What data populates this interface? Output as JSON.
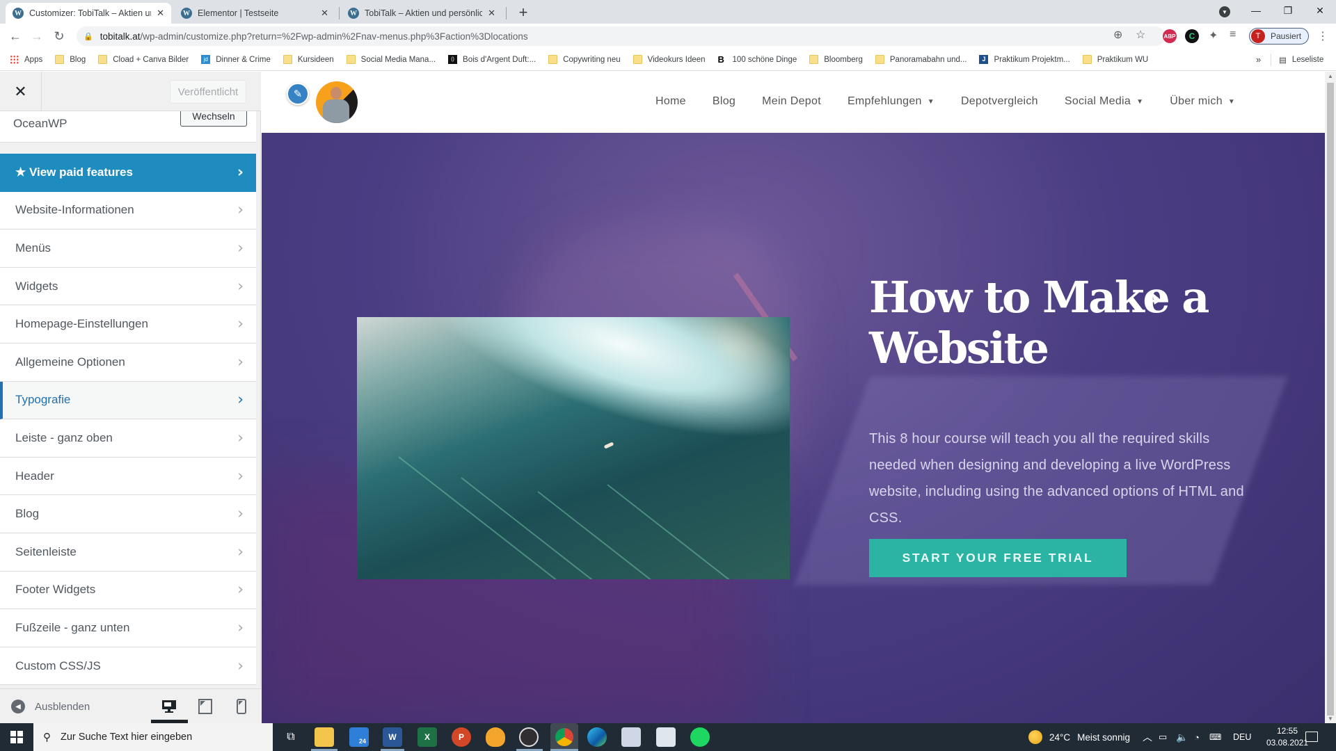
{
  "browser": {
    "tabs": [
      {
        "title": "Customizer: TobiTalk – Aktien und",
        "active": true
      },
      {
        "title": "Elementor | Testseite",
        "active": false
      },
      {
        "title": "TobiTalk – Aktien und persönliche",
        "active": false
      }
    ],
    "new_tab_label": "+",
    "window_controls": {
      "minimize": "—",
      "maximize": "❐",
      "close": "✕"
    },
    "address": {
      "host": "tobitalk.at",
      "path": "/wp-admin/customize.php?return=%2Fwp-admin%2Fnav-menus.php%3Faction%3Dlocations"
    },
    "profile": {
      "initial": "T",
      "status": "Pausiert"
    },
    "extensions": [
      "ABP",
      "C"
    ],
    "bookmarks": [
      {
        "label": "Apps",
        "icon": "apps-grid-icon"
      },
      {
        "label": "Blog",
        "icon": "folder-icon"
      },
      {
        "label": "Cload + Canva Bilder",
        "icon": "folder-icon"
      },
      {
        "label": "Dinner & Crime",
        "icon": "jd-icon"
      },
      {
        "label": "Kursideen",
        "icon": "folder-icon"
      },
      {
        "label": "Social Media Mana...",
        "icon": "folder-icon"
      },
      {
        "label": "Bois d'Argent Duft:...",
        "icon": "bois-icon"
      },
      {
        "label": "Copywriting neu",
        "icon": "folder-icon"
      },
      {
        "label": "Videokurs Ideen",
        "icon": "folder-icon"
      },
      {
        "label": "100 schöne Dinge",
        "icon": "b-icon"
      },
      {
        "label": "Bloomberg",
        "icon": "folder-icon"
      },
      {
        "label": "Panoramabahn und...",
        "icon": "folder-icon"
      },
      {
        "label": "Praktikum Projektm...",
        "icon": "j-icon"
      },
      {
        "label": "Praktikum WU",
        "icon": "folder-icon"
      }
    ],
    "bookmarks_more": "»",
    "reading_list": "Leseliste"
  },
  "customizer": {
    "close_label": "✕",
    "publish_label": "Veröffentlicht",
    "theme_name": "OceanWP",
    "change_theme_label": "Wechseln",
    "paid_features_label": "★ View paid features",
    "sections": [
      {
        "label": "Website-Informationen"
      },
      {
        "label": "Menüs"
      },
      {
        "label": "Widgets"
      },
      {
        "label": "Homepage-Einstellungen"
      },
      {
        "label": "Allgemeine Optionen"
      },
      {
        "label": "Typografie",
        "active": true
      },
      {
        "label": "Leiste - ganz oben"
      },
      {
        "label": "Header"
      },
      {
        "label": "Blog"
      },
      {
        "label": "Seitenleiste"
      },
      {
        "label": "Footer Widgets"
      },
      {
        "label": "Fußzeile - ganz unten"
      },
      {
        "label": "Custom CSS/JS"
      }
    ],
    "hide_label": "Ausblenden",
    "devices": [
      "desktop",
      "tablet",
      "mobile"
    ],
    "active_device": "desktop",
    "accent_color": "#2271b1",
    "paid_color": "#1e8cbe"
  },
  "site": {
    "nav": [
      {
        "label": "Home",
        "dropdown": false
      },
      {
        "label": "Blog",
        "dropdown": false
      },
      {
        "label": "Mein Depot",
        "dropdown": false
      },
      {
        "label": "Empfehlungen",
        "dropdown": true
      },
      {
        "label": "Depotvergleich",
        "dropdown": false
      },
      {
        "label": "Social Media",
        "dropdown": true
      },
      {
        "label": "Über mich",
        "dropdown": true
      }
    ],
    "hero": {
      "title": "How to Make a Website",
      "text": "This 8 hour course will teach you all the required skills needed when designing and developing a live WordPress website, including using the advanced options of HTML and CSS.",
      "cta": "START YOUR FREE TRIAL",
      "cta_color": "#2bb3a3"
    }
  },
  "taskbar": {
    "search_placeholder": "Zur Suche Text hier eingeben",
    "apps": [
      "task-view",
      "file-explorer",
      "mail",
      "word",
      "excel",
      "powerpoint",
      "audacity",
      "obs",
      "chrome",
      "edge",
      "remote-desktop",
      "notepad",
      "spotify"
    ],
    "mail_badge": "24",
    "weather": {
      "temp": "24°C",
      "desc": "Meist sonnig"
    },
    "language": "DEU",
    "time": "12:55",
    "date": "03.08.2021"
  }
}
